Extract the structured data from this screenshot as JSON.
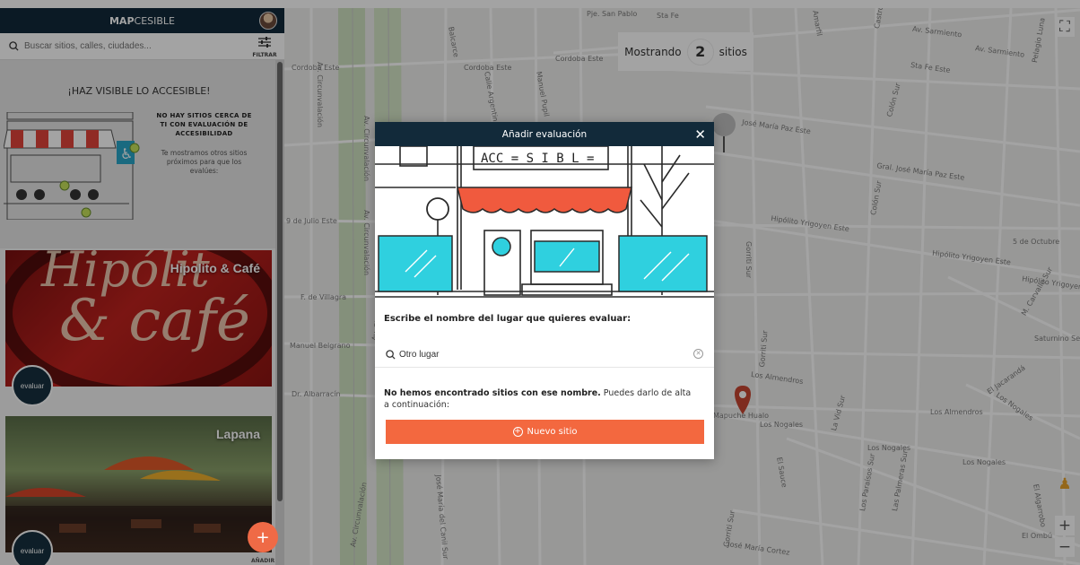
{
  "app": {
    "title_bold": "MAP",
    "title_rest": "CESIBLE"
  },
  "search": {
    "placeholder": "Buscar sitios, calles, ciudades...",
    "filter_label": "FILTRAR"
  },
  "intro": {
    "title": "¡HAZ VISIBLE LO ACCESIBLE!",
    "bold_text": "NO HAY SITIOS CERCA DE TI CON EVALUACIÓN DE ACCESIBILIDAD",
    "text": "Te mostramos otros sitios próximos para que los evalúes:"
  },
  "places": [
    {
      "name": "Hipolito & Café",
      "action": "evaluar"
    },
    {
      "name": "Lapana",
      "action": "evaluar"
    }
  ],
  "fab": {
    "icon": "plus-icon",
    "label": "AÑADIR"
  },
  "map": {
    "showing_prefix": "Mostrando",
    "showing_count": "2",
    "showing_suffix": "sitios",
    "streets": [
      "Pje. San Pablo",
      "Sta Fe",
      "Av. Sarmiento",
      "Av. Sarmiento",
      "Cordoba Este",
      "Cordoba Este",
      "Cordoba Este",
      "Sta Fe Este",
      "Av. Circunvalación",
      "Av. Circunvalación",
      "Av. Circunvalación",
      "Av. Circunvalación",
      "Av. Circunvalación",
      "José María Paz Este",
      "Gral. José María Paz Este",
      "Hipólito Yrigoyen Este",
      "Hipólito Yrigoyen Este",
      "Hipólito Yrigoyen",
      "9 de Julio Este",
      "F. de Villagra",
      "Manuel Belgrano",
      "Dr. Albarracín",
      "Los Almendros",
      "Los Almendros",
      "Los Nogales",
      "Los Nogales",
      "Los Nogales",
      "Colón Sur",
      "Colón Sur",
      "Gorriti Sur",
      "Gorriti Sur",
      "Gorriti Sur",
      "El Jacarandá",
      "Los Nogales",
      "5 de Octubre",
      "Saturnino Sea",
      "José María Cortez",
      "Las Palmeras Sur",
      "Los Paraísos Sur",
      "La Vid Sur",
      "El Sauce",
      "El Ombú",
      "El Algarrobo",
      "José María del Canil Sur",
      "Amarfil",
      "Castro",
      "Pelagio Luna",
      "M. Carvallo Sur",
      "Manuel Pupil",
      "Calle Argentina",
      "Balcarce",
      "Mapuche Hualo"
    ]
  },
  "modal": {
    "title": "Añadir evaluación",
    "question": "Escribe el nombre del lugar que quieres evaluar:",
    "search_value": "Otro lugar",
    "msg_bold": "No hemos encontrado sitios con ese nombre.",
    "msg_rest": " Puedes darlo de alta a continuación:",
    "new_button": "Nuevo sitio",
    "sign_text": "ACC = S I B L ="
  },
  "colors": {
    "header": "#122a3a",
    "accent": "#f3683f",
    "awning": "#f05a3e",
    "window": "#2fd0df"
  }
}
